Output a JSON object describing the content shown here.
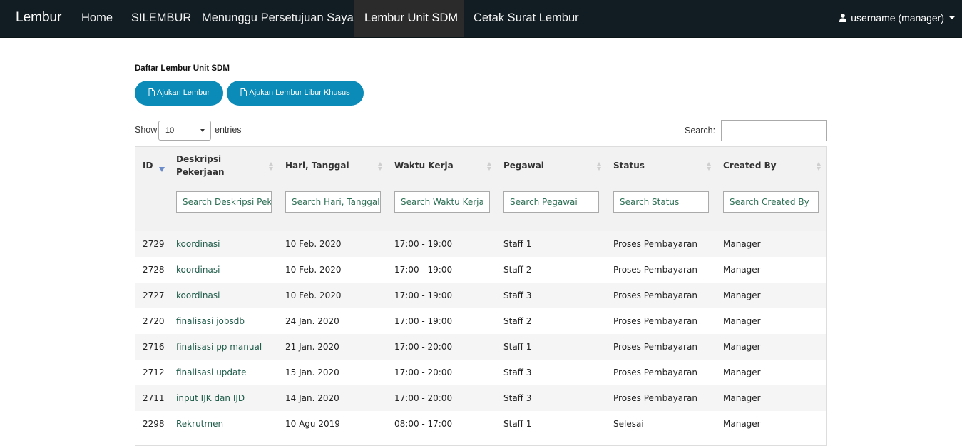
{
  "navbar": {
    "brand": "Lembur",
    "items": [
      {
        "label": "Home"
      },
      {
        "label": "SILEMBUR"
      },
      {
        "label": "Menunggu Persetujuan Saya"
      },
      {
        "label": "Lembur Unit SDM"
      },
      {
        "label": "Cetak Surat Lembur"
      }
    ],
    "active_index": 3,
    "user": "username (manager)",
    "colors": {
      "background": "#111d22",
      "active": "#2b2b2b"
    }
  },
  "page": {
    "title": "Daftar Lembur Unit SDM",
    "buttons": {
      "ajukan_lembur": "Ajukan Lembur",
      "ajukan_libur_khusus": "Ajukan Lembur Libur Khusus"
    },
    "button_color": "#0b8bb8"
  },
  "table_controls": {
    "show_label": "Show",
    "page_length": "10",
    "entries_label": "entries",
    "search_label": "Search:",
    "search_value": ""
  },
  "table": {
    "columns": [
      {
        "label": "ID",
        "search_placeholder": ""
      },
      {
        "label": "Deskripsi Pekerjaan",
        "search_placeholder": "Search Deskripsi Pekerjaan"
      },
      {
        "label": "Hari, Tanggal",
        "search_placeholder": "Search Hari, Tanggal"
      },
      {
        "label": "Waktu Kerja",
        "search_placeholder": "Search Waktu Kerja"
      },
      {
        "label": "Pegawai",
        "search_placeholder": "Search Pegawai"
      },
      {
        "label": "Status",
        "search_placeholder": "Search Status"
      },
      {
        "label": "Created By",
        "search_placeholder": "Search Created By"
      }
    ],
    "sorted_column": "ID",
    "rows": [
      [
        "2729",
        "koordinasi",
        "10 Feb. 2020",
        "17:00 - 19:00",
        "Staff 1",
        "Proses Pembayaran",
        "Manager"
      ],
      [
        "2728",
        "koordinasi",
        "10 Feb. 2020",
        "17:00 - 19:00",
        "Staff 2",
        "Proses Pembayaran",
        "Manager"
      ],
      [
        "2727",
        "koordinasi",
        "10 Feb. 2020",
        "17:00 - 19:00",
        "Staff 3",
        "Proses Pembayaran",
        "Manager"
      ],
      [
        "2720",
        "finalisasi jobsdb",
        "24 Jan. 2020",
        "17:00 - 19:00",
        "Staff 2",
        "Proses Pembayaran",
        "Manager"
      ],
      [
        "2716",
        "finalisasi pp manual",
        "21 Jan. 2020",
        "17:00 - 20:00",
        "Staff 1",
        "Proses Pembayaran",
        "Manager"
      ],
      [
        "2712",
        "finalisasi update",
        "15 Jan. 2020",
        "17:00 - 20:00",
        "Staff 3",
        "Proses Pembayaran",
        "Manager"
      ],
      [
        "2711",
        "input IJK dan IJD",
        "14 Jan. 2020",
        "17:00 - 20:00",
        "Staff 3",
        "Proses Pembayaran",
        "Manager"
      ],
      [
        "2298",
        "Rekrutmen",
        "10 Agu 2019",
        "08:00 - 17:00",
        "Staff 1",
        "Selesai",
        "Manager"
      ]
    ]
  }
}
